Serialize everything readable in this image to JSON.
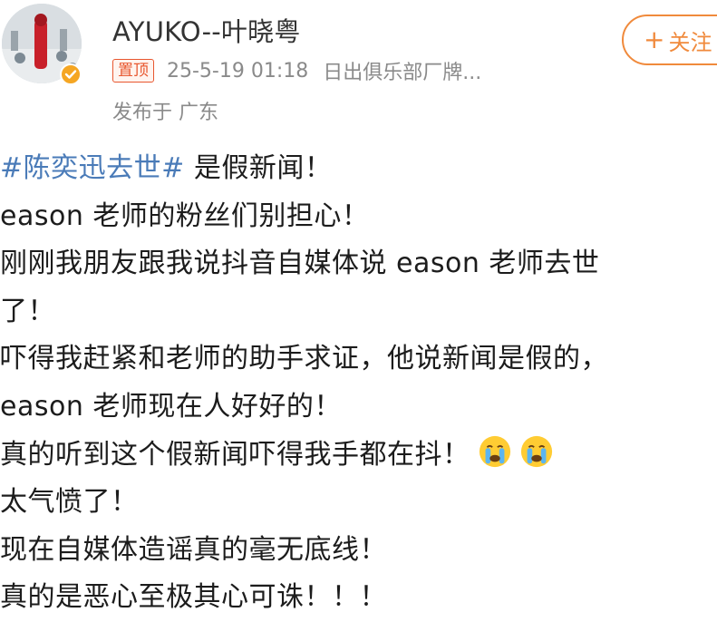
{
  "user": {
    "name": "AYUKO--叶晓粤",
    "pin_badge": "置顶",
    "timestamp": "25-5-19 01:18",
    "source": "日出俱乐部厂牌...",
    "location": "发布于 广东"
  },
  "follow_button": {
    "label": "关注"
  },
  "post": {
    "topic": "#陈奕迅去世#",
    "line1_rest": " 是假新闻！",
    "line2": "eason 老师的粉丝们别担心！",
    "line3": "刚刚我朋友跟我说抖音自媒体说 eason 老师去世",
    "line4": "了！",
    "line5": "吓得我赶紧和老师的助手求证，他说新闻是假的，",
    "line6": "eason 老师现在人好好的！",
    "line7": "真的听到这个假新闻吓得我手都在抖！",
    "line8": "太气愤了！",
    "line9": "现在自媒体造谣真的毫无底线！",
    "line10": "真的是恶心至极其心可诛！！！"
  },
  "icons": {
    "verified": "verified-badge-icon",
    "emoji": "crying-face-icon",
    "colors": {
      "verified": "#f5a623",
      "topic": "#4a7bb8",
      "pin": "#e8572f",
      "follow": "#f08a3c"
    }
  }
}
